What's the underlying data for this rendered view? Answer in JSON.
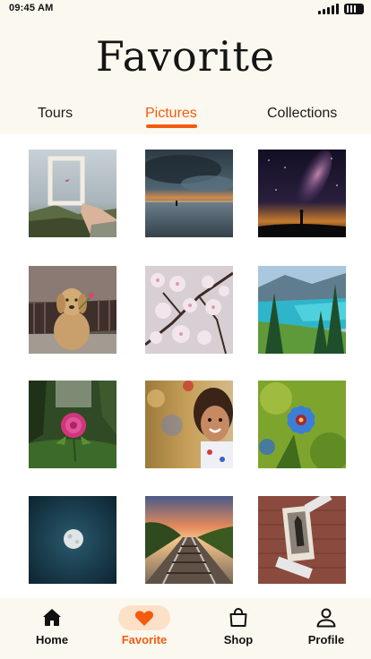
{
  "status_bar": {
    "time": "09:45 AM"
  },
  "header": {
    "title": "Favorite"
  },
  "tabs": [
    {
      "label": "Tours",
      "active": false
    },
    {
      "label": "Pictures",
      "active": true
    },
    {
      "label": "Collections",
      "active": false
    }
  ],
  "pictures": [
    {
      "subject": "hand holding picture frame over coastline"
    },
    {
      "subject": "storm clouds over sea at sunset"
    },
    {
      "subject": "milky way over silhouette"
    },
    {
      "subject": "golden retriever puppy with flower"
    },
    {
      "subject": "cherry blossom branches"
    },
    {
      "subject": "turquoise mountain lake with pine trees"
    },
    {
      "subject": "pink flower in garden"
    },
    {
      "subject": "smiling little girl"
    },
    {
      "subject": "blue flower closeup"
    },
    {
      "subject": "moon in dark sky"
    },
    {
      "subject": "railway tracks at sunset"
    },
    {
      "subject": "photo taped on brick wall"
    }
  ],
  "bottom_nav": [
    {
      "label": "Home",
      "icon": "home-icon",
      "active": false
    },
    {
      "label": "Favorite",
      "icon": "heart-icon",
      "active": true
    },
    {
      "label": "Shop",
      "icon": "shopping-bag-icon",
      "active": false
    },
    {
      "label": "Profile",
      "icon": "profile-icon",
      "active": false
    }
  ],
  "colors": {
    "accent": "#f45b0f",
    "accent_soft": "#fde0c8",
    "header_background": "#fbf9ef"
  }
}
